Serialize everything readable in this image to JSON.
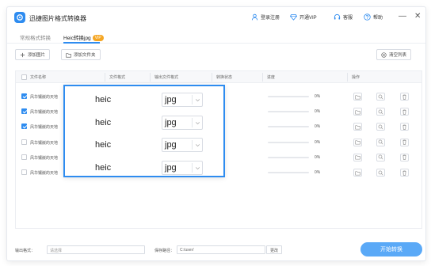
{
  "app": {
    "title": "迅捷图片格式转换器"
  },
  "titlebar": {
    "login": "登录注册",
    "vip": "开通VIP",
    "service": "客服",
    "help": "帮助"
  },
  "tabs": [
    {
      "label": "常规格式转换"
    },
    {
      "label": "Heic转换jpg",
      "badge": "VIP"
    }
  ],
  "toolbar": {
    "add_image": "添加图片",
    "add_folder": "添加文件夹",
    "clear_list": "清空列表"
  },
  "table": {
    "headers": {
      "name": "文件名称",
      "format": "文件格式",
      "output_format": "输出文件格式",
      "status": "转换状态",
      "progress": "进度",
      "ops": "操作"
    },
    "rows": [
      {
        "checked": true,
        "name": "风华镶嵌的天地",
        "progress": 0,
        "progress_text": "0%"
      },
      {
        "checked": true,
        "name": "风华镶嵌的天地",
        "progress": 0,
        "progress_text": "0%"
      },
      {
        "checked": true,
        "name": "风华镶嵌的天地",
        "progress": 0,
        "progress_text": "0%"
      },
      {
        "checked": false,
        "name": "风华镶嵌的天地",
        "progress": 0,
        "progress_text": "0%"
      },
      {
        "checked": false,
        "name": "风华镶嵌的天地",
        "progress": 0,
        "progress_text": "0%"
      },
      {
        "checked": false,
        "name": "风华镶嵌的天地",
        "progress": 0,
        "progress_text": "0%"
      }
    ]
  },
  "overlay": {
    "rows": [
      {
        "format": "heic",
        "output": "jpg"
      },
      {
        "format": "heic",
        "output": "jpg"
      },
      {
        "format": "heic",
        "output": "jpg"
      },
      {
        "format": "heic",
        "output": "jpg"
      }
    ]
  },
  "footer": {
    "output_format_label": "输出格式：",
    "output_format_placeholder": "请选择",
    "save_path_label": "保存路径：",
    "save_path_value": "C:/user/",
    "change_button": "更改",
    "start_button": "开始转换"
  },
  "icons": {
    "logo": "app-logo-icon",
    "login": "user-icon",
    "vip": "diamond-icon",
    "service": "headset-icon",
    "help": "help-icon",
    "minimize": "minimize-icon",
    "close": "close-icon",
    "add_image": "plus-icon",
    "add_folder": "folder-icon",
    "clear": "clear-icon",
    "open_folder": "folder-open-icon",
    "preview": "search-icon",
    "delete": "trash-icon",
    "dropdown": "chevron-down-icon"
  },
  "colors": {
    "accent": "#2e8cf0",
    "vip": "#f5a623",
    "start_button": "#5aa9f7"
  }
}
